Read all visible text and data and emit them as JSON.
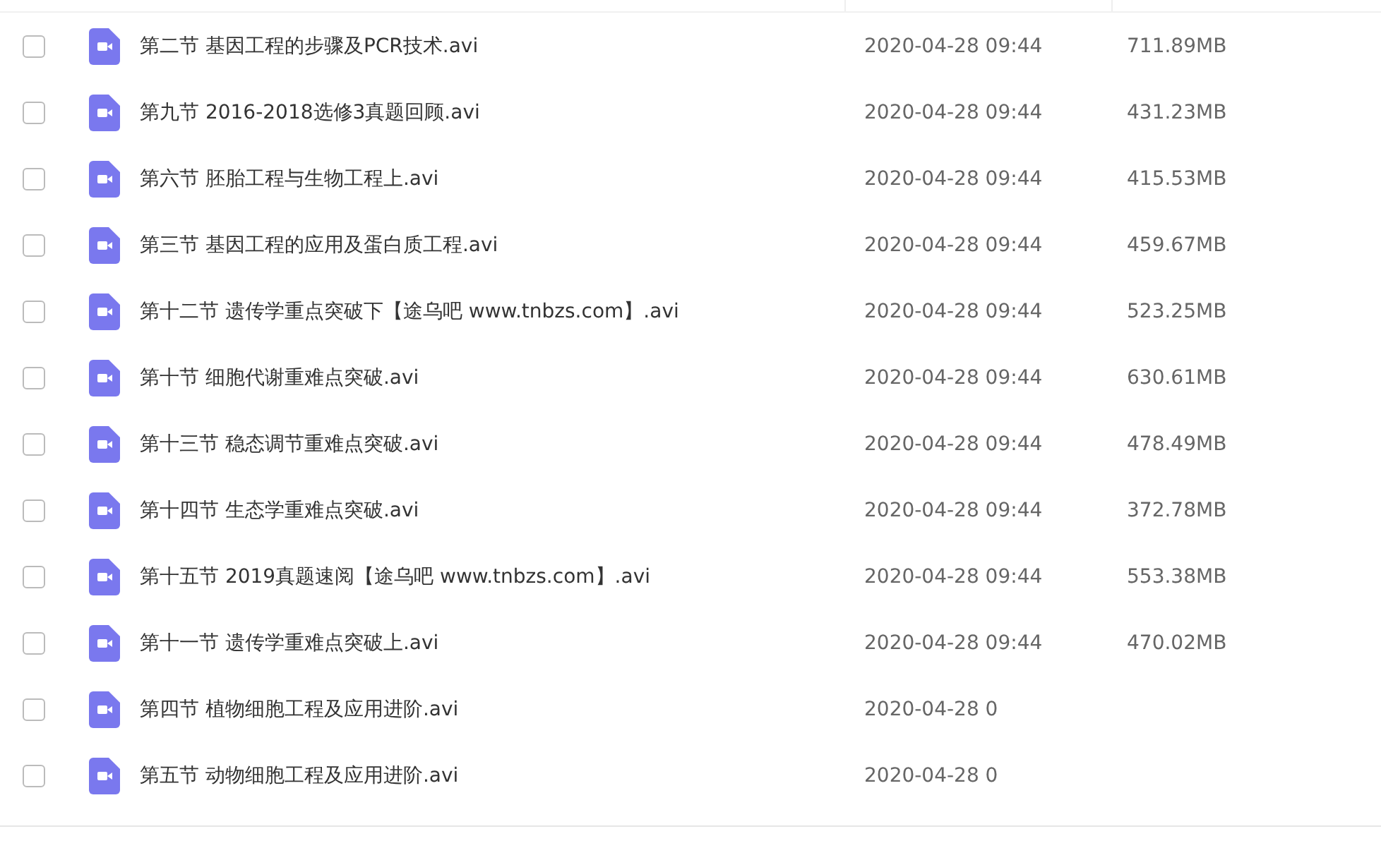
{
  "files": [
    {
      "name": "第二节 基因工程的步骤及PCR技术.avi",
      "date": "2020-04-28 09:44",
      "size": "711.89MB",
      "checked": false
    },
    {
      "name": "第九节 2016-2018选修3真题回顾.avi",
      "date": "2020-04-28 09:44",
      "size": "431.23MB",
      "checked": false
    },
    {
      "name": "第六节 胚胎工程与生物工程上.avi",
      "date": "2020-04-28 09:44",
      "size": "415.53MB",
      "checked": false
    },
    {
      "name": "第三节 基因工程的应用及蛋白质工程.avi",
      "date": "2020-04-28 09:44",
      "size": "459.67MB",
      "checked": false
    },
    {
      "name": "第十二节 遗传学重点突破下【途乌吧 www.tnbzs.com】.avi",
      "date": "2020-04-28 09:44",
      "size": "523.25MB",
      "checked": false
    },
    {
      "name": "第十节 细胞代谢重难点突破.avi",
      "date": "2020-04-28 09:44",
      "size": "630.61MB",
      "checked": false
    },
    {
      "name": "第十三节 稳态调节重难点突破.avi",
      "date": "2020-04-28 09:44",
      "size": "478.49MB",
      "checked": false
    },
    {
      "name": "第十四节 生态学重难点突破.avi",
      "date": "2020-04-28 09:44",
      "size": "372.78MB",
      "checked": false
    },
    {
      "name": "第十五节 2019真题速阅【途乌吧 www.tnbzs.com】.avi",
      "date": "2020-04-28 09:44",
      "size": "553.38MB",
      "checked": false
    },
    {
      "name": "第十一节 遗传学重难点突破上.avi",
      "date": "2020-04-28 09:44",
      "size": "470.02MB",
      "checked": false
    },
    {
      "name": "第四节 植物细胞工程及应用进阶.avi",
      "date": "2020-04-28 0",
      "checked": false
    },
    {
      "name": "第五节 动物细胞工程及应用进阶.avi",
      "date": "2020-04-28 0",
      "checked": false
    }
  ]
}
